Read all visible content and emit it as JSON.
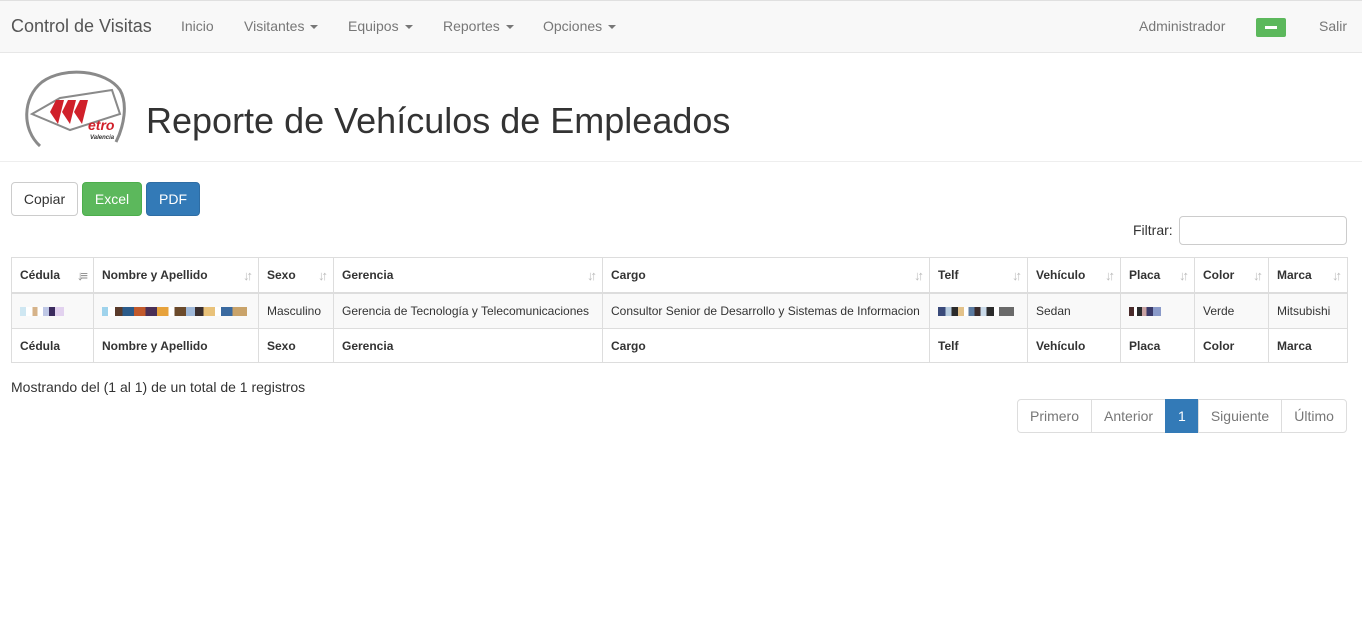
{
  "nav": {
    "brand": "Control de Visitas",
    "items": [
      {
        "label": "Inicio",
        "dropdown": false
      },
      {
        "label": "Visitantes",
        "dropdown": true
      },
      {
        "label": "Equipos",
        "dropdown": true
      },
      {
        "label": "Reportes",
        "dropdown": true
      },
      {
        "label": "Opciones",
        "dropdown": true
      }
    ],
    "user": "Administrador",
    "logout": "Salir"
  },
  "logo": {
    "text": "etro",
    "subtext": "Valencia"
  },
  "page_title": "Reporte de Vehículos de Empleados",
  "export_buttons": {
    "copy": "Copiar",
    "excel": "Excel",
    "pdf": "PDF"
  },
  "filter": {
    "label": "Filtrar:",
    "value": ""
  },
  "table": {
    "columns": [
      "Cédula",
      "Nombre y Apellido",
      "Sexo",
      "Gerencia",
      "Cargo",
      "Telf",
      "Vehículo",
      "Placa",
      "Color",
      "Marca"
    ],
    "rows": [
      {
        "cedula": "",
        "nombre": "",
        "sexo": "Masculino",
        "gerencia": "Gerencia de Tecnología y Telecomunicaciones",
        "cargo": "Consultor Senior de Desarrollo y Sistemas de Informacion",
        "telf": "",
        "vehiculo": "Sedan",
        "placa": "",
        "color": "Verde",
        "marca": "Mitsubishi"
      }
    ]
  },
  "info": "Mostrando del (1 al 1) de un total de 1 registros",
  "pagination": {
    "first": "Primero",
    "prev": "Anterior",
    "current": "1",
    "next": "Siguiente",
    "last": "Último"
  },
  "colors": {
    "primary": "#337ab7",
    "success": "#5cb85c",
    "navbar_bg": "#f8f8f8",
    "logo_red": "#d0202a"
  }
}
